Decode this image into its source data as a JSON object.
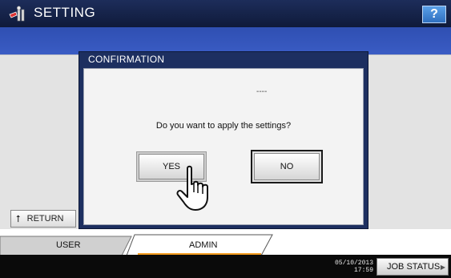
{
  "header": {
    "title": "SETTING",
    "help_label": "?",
    "icon": "tools-settings-icon"
  },
  "return_button": {
    "label": "RETURN",
    "icon": "return-arrow-icon"
  },
  "dialog": {
    "title": "CONFIRMATION",
    "dashes": "----",
    "question": "Do you want to apply the settings?",
    "yes_label": "YES",
    "no_label": "NO"
  },
  "tabs": {
    "user_label": "USER",
    "admin_label": "ADMIN",
    "active": "ADMIN",
    "active_color": "#f39b1e"
  },
  "status": {
    "date": "05/10/2013",
    "time": "17:59",
    "job_status_label": "JOB STATUS"
  },
  "pointer": "hand-pointer-icon"
}
